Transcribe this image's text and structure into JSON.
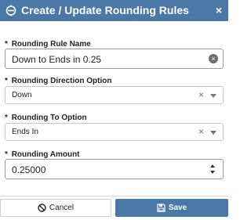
{
  "dialog": {
    "title": "Create / Update Rounding Rules",
    "close_label": "×"
  },
  "form": {
    "rule_name": {
      "label": "Rounding Rule Name",
      "required_mark": "*",
      "value": "Down to Ends in 0.25",
      "clear_icon": "×"
    },
    "direction": {
      "label": "Rounding Direction Option",
      "required_mark": "*",
      "value": "Down",
      "clear_icon": "×"
    },
    "rounding_to": {
      "label": "Rounding To Option",
      "required_mark": "*",
      "value": "Ends In",
      "clear_icon": "×"
    },
    "amount": {
      "label": "Rounding Amount",
      "required_mark": "*",
      "value": "0.25000"
    }
  },
  "footer": {
    "cancel_label": "Cancel",
    "save_label": "Save"
  },
  "colors": {
    "header_bg": "#4a79a8",
    "save_bg": "#4a79a8"
  }
}
